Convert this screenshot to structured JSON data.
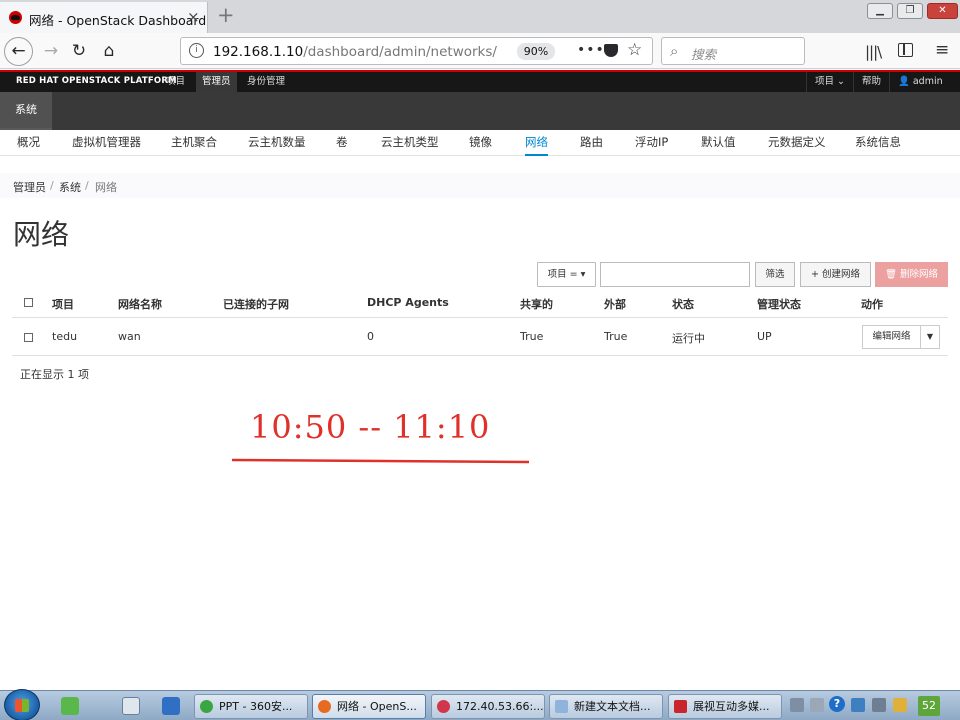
{
  "browser": {
    "tab_title": "网络 - OpenStack Dashboard",
    "close_glyph": "×",
    "newtab_glyph": "+",
    "url_host": "192.168.1.10",
    "url_path": "/dashboard/admin/networks/",
    "zoom": "90%",
    "search_placeholder": "搜索",
    "more_glyph": "•••"
  },
  "header": {
    "brand": "RED HAT OPENSTACK PLATFORM",
    "nav": [
      "项目",
      "管理员",
      "身份管理"
    ],
    "project_menu": "项目 ⌄",
    "help": "帮助",
    "user": "admin ⌄"
  },
  "system_tab": "系统",
  "subnav": [
    "概况",
    "虚拟机管理器",
    "主机聚合",
    "云主机数量",
    "卷",
    "云主机类型",
    "镜像",
    "网络",
    "路由",
    "浮动IP",
    "默认值",
    "元数据定义",
    "系统信息"
  ],
  "breadcrumb": [
    "管理员",
    "系统",
    "网络"
  ],
  "page_title": "网络",
  "toolbar": {
    "filter_field": "项目 = ▾",
    "filter_button": "筛选",
    "create_button": "+ 创建网络",
    "delete_button": "删除网络"
  },
  "table": {
    "headers": [
      "项目",
      "网络名称",
      "已连接的子网",
      "DHCP Agents",
      "共享的",
      "外部",
      "状态",
      "管理状态",
      "动作"
    ],
    "rows": [
      {
        "project": "tedu",
        "name": "wan",
        "subnets": "",
        "dhcp": "0",
        "shared": "True",
        "external": "True",
        "status": "运行中",
        "admin_state": "UP",
        "action": "编辑网络"
      }
    ]
  },
  "table_count": "正在显示 1 项",
  "annotation": "10:50 -- 11:10",
  "taskbar": {
    "items": [
      "PPT - 360安...",
      "网络 - OpenS...",
      "172.40.53.66:...",
      "新建文本文档...",
      "展视互动多媒..."
    ],
    "clock": "52"
  },
  "colors": {
    "accent": "#0088ce",
    "brand_red": "#cc0000",
    "annotation_red": "#e0302a"
  }
}
